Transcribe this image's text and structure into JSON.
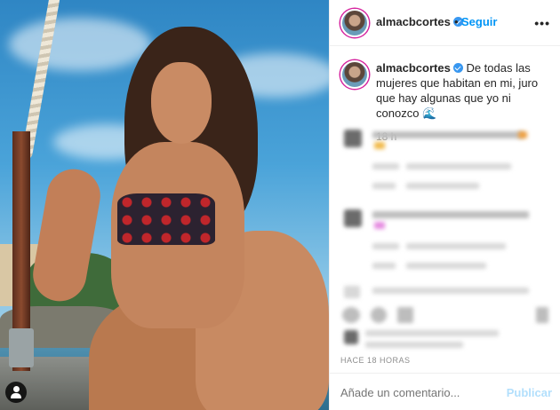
{
  "post": {
    "username": "almacbcortes",
    "follow_label": "Seguir",
    "more_label": "•••",
    "caption_text": "De todas las mujeres que habitan en mi, juro que hay algunas que yo ni conozco 🌊",
    "caption_time": "18 h",
    "timestamp": "HACE 18 HORAS"
  },
  "comment_box": {
    "placeholder": "Añade un comentario...",
    "post_label": "Publicar"
  },
  "colors": {
    "accent": "#0095f6",
    "verified": "#3897f0",
    "publish_disabled": "#b2dffc"
  },
  "icons": [
    "tag-user-icon",
    "verified-badge-icon",
    "more-options-icon"
  ]
}
